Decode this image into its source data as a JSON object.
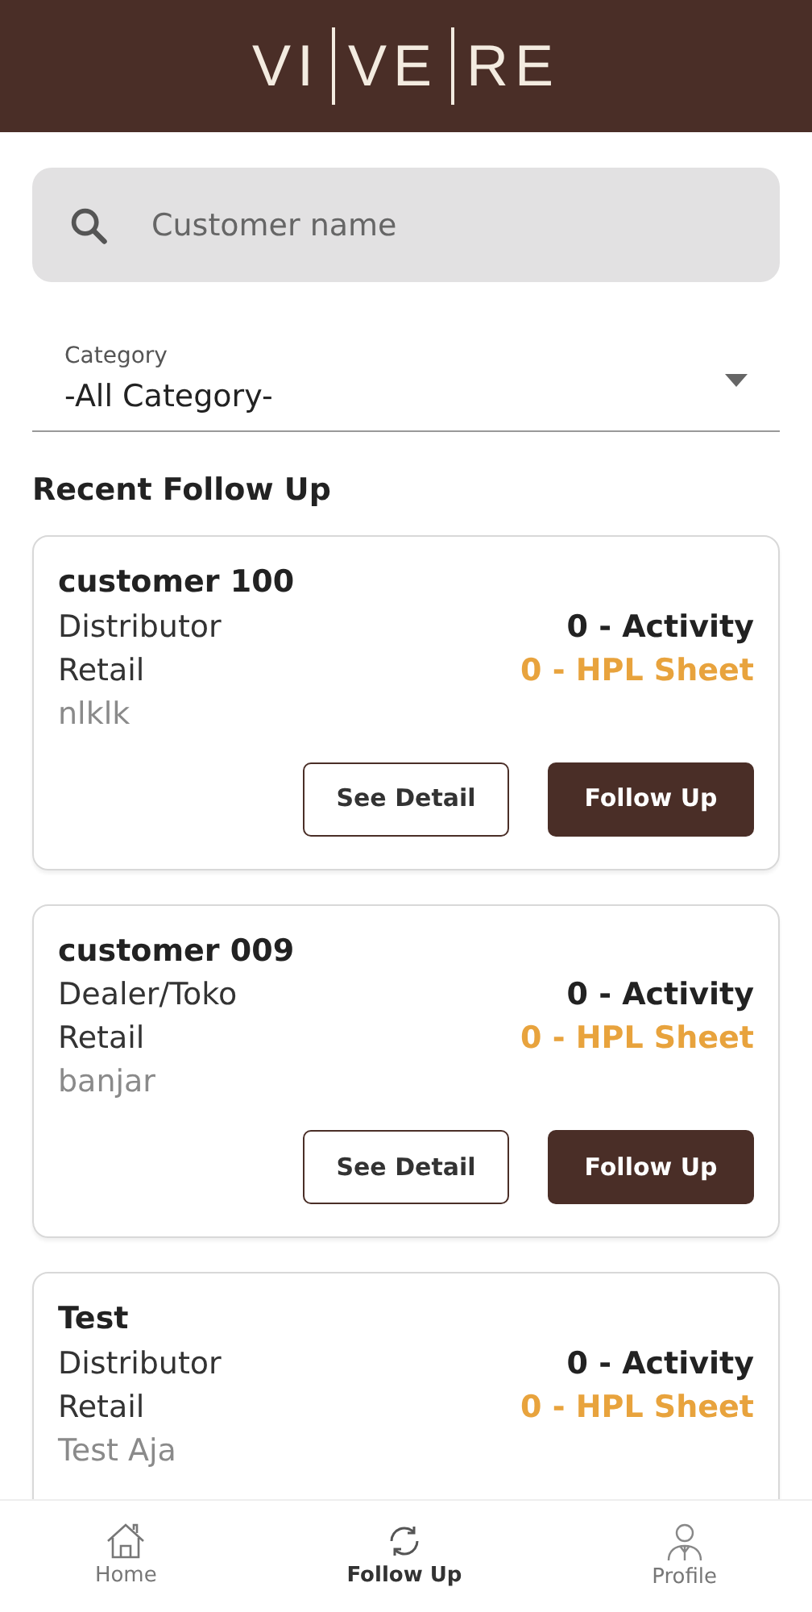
{
  "header": {
    "logo_parts": [
      "VI",
      "VE",
      "RE"
    ]
  },
  "search": {
    "placeholder": "Customer name"
  },
  "category": {
    "label": "Category",
    "value": "-All Category-"
  },
  "section_title": "Recent Follow Up",
  "customers": [
    {
      "name": "customer 100",
      "type": "Distributor",
      "segment": "Retail",
      "note": "nlklk",
      "activity": "0 - Activity",
      "hpl": "0 - HPL Sheet",
      "buttons": [
        "See Detail",
        "Follow Up"
      ]
    },
    {
      "name": "customer 009",
      "type": "Dealer/Toko",
      "segment": "Retail",
      "note": "banjar",
      "activity": "0 - Activity",
      "hpl": "0 - HPL Sheet",
      "buttons": [
        "See Detail",
        "Follow Up"
      ]
    },
    {
      "name": "Test",
      "type": "Distributor",
      "segment": "Retail",
      "note": "Test Aja",
      "activity": "0 - Activity",
      "hpl": "0 - HPL Sheet"
    }
  ],
  "bottom_nav": [
    {
      "kind": "home",
      "label": "Home",
      "selected": false
    },
    {
      "kind": "sync",
      "label": "Follow Up",
      "selected": true
    },
    {
      "kind": "profile",
      "label": "Profile",
      "selected": false
    }
  ]
}
